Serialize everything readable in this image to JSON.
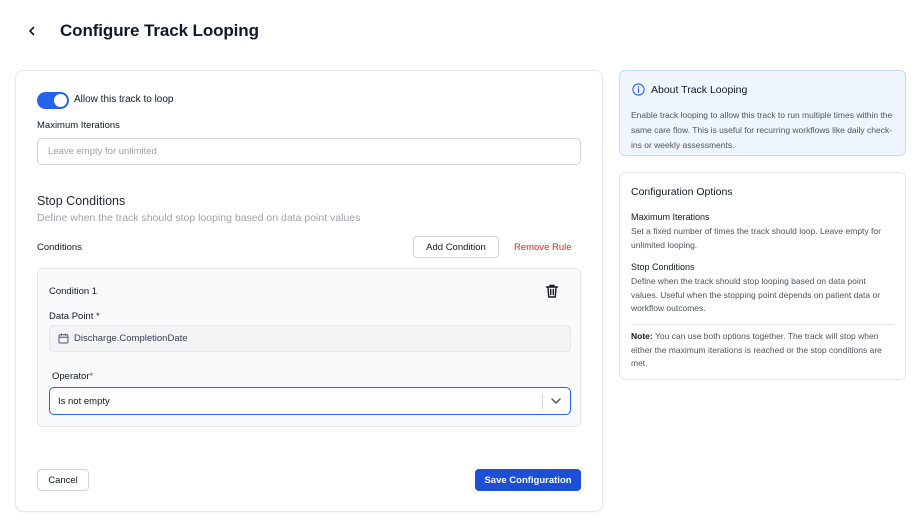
{
  "header": {
    "title": "Configure Track Looping"
  },
  "form": {
    "loop_toggle_label": "Allow this track to loop",
    "loop_enabled": true,
    "max_iterations_label": "Maximum Iterations",
    "max_iterations_value": "",
    "max_iterations_placeholder": "Leave empty for unlimited",
    "stop_conditions_title": "Stop Conditions",
    "stop_conditions_subtitle": "Define when the track should stop looping based on data point values",
    "conditions_label": "Conditions",
    "add_condition_label": "Add Condition",
    "remove_rule_label": "Remove Rule",
    "conditions": [
      {
        "title": "Condition 1",
        "data_point_label": "Data Point *",
        "data_point_value": "Discharge.CompletionDate",
        "operator_label": "Operator",
        "operator_required_mark": "*",
        "operator_value": "Is not empty"
      }
    ],
    "cancel_label": "Cancel",
    "save_label": "Save Configuration"
  },
  "about": {
    "title": "About Track Looping",
    "body": "Enable track looping to allow this track to run multiple times within the same care flow. This is useful for recurring workflows like daily check-ins or weekly assessments."
  },
  "options": {
    "title": "Configuration Options",
    "max_iterations_heading": "Maximum Iterations",
    "max_iterations_text": "Set a fixed number of times the track should loop. Leave empty for unlimited looping.",
    "stop_conditions_heading": "Stop Conditions",
    "stop_conditions_text": "Define when the track should stop looping based on data point values. Useful when the stopping point depends on patient data or workflow outcomes.",
    "note_label": "Note:",
    "note_text": "You can use both options together. The track will stop when either the maximum iterations is reached or the stop conditions are met."
  },
  "colors": {
    "accent": "#2563eb",
    "primary_button": "#1d4ed8",
    "danger": "#dc2626",
    "info_bg": "#eff6ff"
  },
  "icons": {
    "back": "chevron-left-icon",
    "info": "info-icon",
    "trash": "trash-icon",
    "calendar": "calendar-icon",
    "chevron_down": "chevron-down-icon"
  }
}
